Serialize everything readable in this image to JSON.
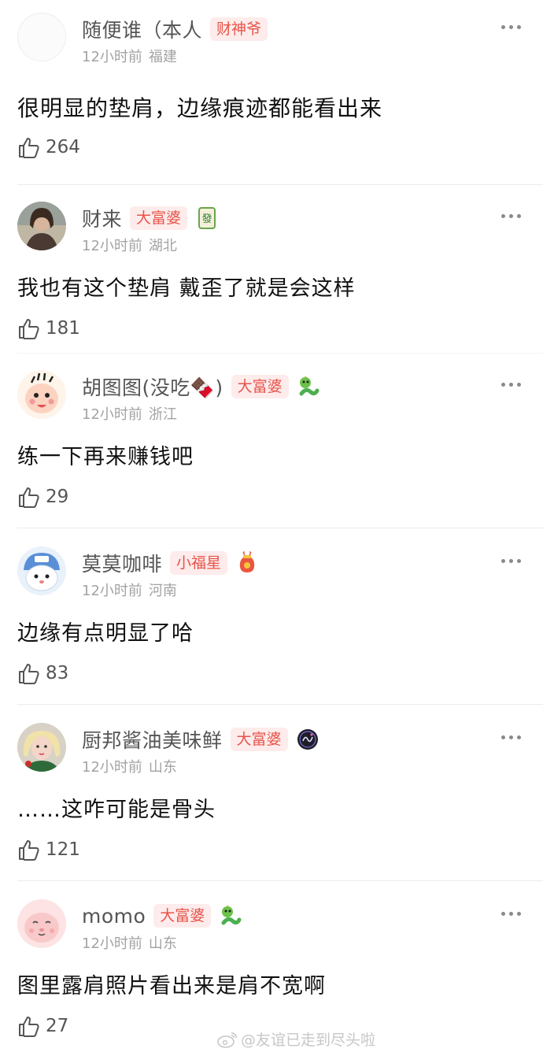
{
  "comments": [
    {
      "username": "随便谁（本人",
      "badge": "财神爷",
      "badge_icon": "",
      "time": "12小时前",
      "location": "福建",
      "content": "很明显的垫肩，边缘痕迹都能看出来",
      "likes": "264",
      "avatar": "blank-avatar"
    },
    {
      "username": "财来",
      "badge": "大富婆",
      "badge_icon": "mahjong-tile-icon",
      "time": "12小时前",
      "location": "湖北",
      "content": "我也有这个垫肩 戴歪了就是会这样",
      "likes": "181",
      "avatar": "photo-avatar"
    },
    {
      "username": "胡图图(没吃🍫)",
      "badge": "大富婆",
      "badge_icon": "green-snake-icon",
      "time": "12小时前",
      "location": "浙江",
      "content": "练一下再来赚钱吧",
      "likes": "29",
      "avatar": "cartoon-boy-avatar"
    },
    {
      "username": "莫莫咖啡",
      "badge": "小福星",
      "badge_icon": "lucky-bag-icon",
      "time": "12小时前",
      "location": "河南",
      "content": "边缘有点明显了哈",
      "likes": "83",
      "avatar": "cartoon-hamster-avatar"
    },
    {
      "username": "厨邦酱油美味鲜",
      "badge": "大富婆",
      "badge_icon": "dark-medal-icon",
      "time": "12小时前",
      "location": "山东",
      "content": "……这咋可能是骨头",
      "likes": "121",
      "avatar": "blonde-girl-avatar"
    },
    {
      "username": "momo",
      "badge": "大富婆",
      "badge_icon": "green-snake-icon",
      "time": "12小时前",
      "location": "山东",
      "content": "图里露肩照片看出来是肩不宽啊",
      "likes": "27",
      "avatar": "pink-face-avatar"
    }
  ],
  "watermark": "@友谊已走到尽头啦"
}
